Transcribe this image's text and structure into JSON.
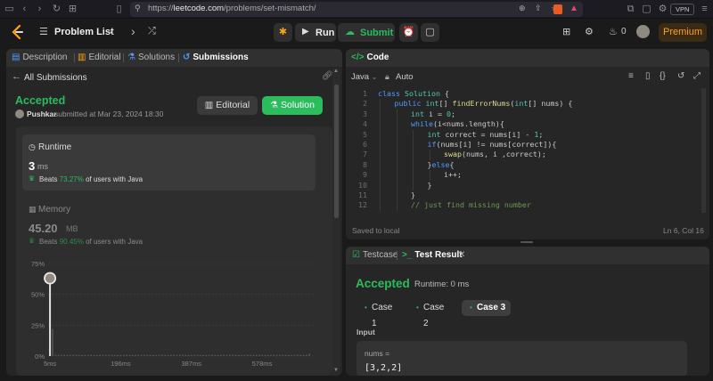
{
  "browser": {
    "url_prefix": "https://",
    "url_domain": "leetcode.com",
    "url_path": "/problems/set-mismatch/",
    "vpn_label": "VPN"
  },
  "topbar": {
    "problem_list_label": "Problem List",
    "run_label": "Run",
    "submit_label": "Submit",
    "streak_count": "0",
    "premium_label": "Premium"
  },
  "left_tabs": {
    "description": "Description",
    "editorial": "Editorial",
    "solutions": "Solutions",
    "submissions": "Submissions"
  },
  "submission": {
    "back_label": "All Submissions",
    "status": "Accepted",
    "user": "Pushkar",
    "submitted_text": "submitted at Mar 23, 2024 18:30",
    "editorial_button": "Editorial",
    "solution_button": "Solution",
    "runtime_title": "Runtime",
    "runtime_value": "3",
    "runtime_unit": "ms",
    "runtime_beats_prefix": "Beats",
    "runtime_beats_pct": "73.27%",
    "runtime_beats_suffix": "of users with Java",
    "memory_title": "Memory",
    "memory_value": "45.20",
    "memory_unit": "MB",
    "memory_beats_prefix": "Beats",
    "memory_beats_pct": "90.45%",
    "memory_beats_suffix": "of users with Java"
  },
  "chart_data": {
    "type": "bar",
    "y_ticks": [
      "75%",
      "50%",
      "25%",
      "0%"
    ],
    "y_tick_values": [
      75,
      50,
      25,
      0
    ],
    "x_ticks": [
      "5ms",
      "196ms",
      "387ms",
      "578ms"
    ],
    "x_tick_values": [
      5,
      196,
      387,
      578
    ],
    "ylim": [
      0,
      75
    ],
    "xlim": [
      0,
      720
    ],
    "highlight_x": 5,
    "highlight_y": 58,
    "values_x": [
      5,
      12,
      20,
      28,
      36,
      44,
      52,
      60,
      68,
      76,
      84,
      92,
      100,
      108,
      116,
      124,
      132,
      140,
      148,
      156,
      164,
      172,
      180,
      188,
      196,
      204,
      212,
      220,
      228,
      236,
      244,
      252,
      260,
      268,
      276,
      284,
      292,
      300,
      308,
      316,
      324,
      332,
      340,
      348,
      356,
      364,
      372,
      380,
      387,
      395,
      403,
      411,
      419,
      427,
      435,
      443,
      451,
      459,
      467,
      475,
      483,
      491,
      499,
      507,
      515,
      523,
      531,
      539,
      547,
      555,
      563,
      571,
      578,
      586,
      594,
      602,
      610,
      618,
      626,
      634,
      642,
      650,
      658,
      666,
      674,
      682,
      690,
      698,
      706
    ],
    "values_y": [
      58,
      22,
      1,
      1,
      1,
      1,
      1,
      1,
      1,
      1,
      1,
      1,
      1,
      1,
      1,
      1,
      1,
      1,
      1,
      1,
      1,
      1,
      1,
      1,
      1,
      1,
      1,
      1,
      1,
      1,
      1,
      1,
      1,
      1,
      1,
      1,
      1,
      1,
      1,
      1,
      1,
      1,
      1,
      1,
      1,
      1,
      1,
      1,
      1,
      1,
      1,
      1,
      1,
      1,
      1,
      1,
      1,
      1,
      1,
      1,
      1,
      1,
      1,
      1,
      1,
      1,
      1,
      1,
      1,
      1,
      1,
      1,
      1,
      1,
      1,
      1,
      1,
      1,
      1,
      1,
      1,
      1,
      1,
      1,
      1,
      1,
      1,
      1,
      2
    ]
  },
  "editor": {
    "tab_label": "Code",
    "language": "Java",
    "mode": "Auto",
    "status_left": "Saved to local",
    "status_right": "Ln 6, Col 16",
    "lines": [
      {
        "n": "1",
        "indent": 0,
        "parts": [
          [
            "kw",
            "class "
          ],
          [
            "ty",
            "Solution "
          ],
          [
            "pl",
            "{"
          ]
        ]
      },
      {
        "n": "2",
        "indent": 1,
        "parts": [
          [
            "kw",
            "public "
          ],
          [
            "ty",
            "int"
          ],
          [
            "pl",
            "[] "
          ],
          [
            "fn",
            "findErrorNums"
          ],
          [
            "pl",
            "("
          ],
          [
            "ty",
            "int"
          ],
          [
            "pl",
            "[] nums) {"
          ]
        ]
      },
      {
        "n": "3",
        "indent": 2,
        "parts": [
          [
            "ty",
            "int "
          ],
          [
            "pl",
            "i = "
          ],
          [
            "ty",
            "0"
          ],
          [
            "pl",
            ";"
          ]
        ]
      },
      {
        "n": "4",
        "indent": 2,
        "parts": [
          [
            "kw",
            "while"
          ],
          [
            "pl",
            "(i<nums.length){"
          ]
        ]
      },
      {
        "n": "5",
        "indent": 3,
        "parts": [
          [
            "ty",
            "int "
          ],
          [
            "pl",
            "correct = nums[i] - "
          ],
          [
            "ty",
            "1"
          ],
          [
            "pl",
            ";"
          ]
        ]
      },
      {
        "n": "6",
        "indent": 3,
        "parts": [
          [
            "kw",
            "if"
          ],
          [
            "pl",
            "(nums[i] != nums[correct]){"
          ]
        ]
      },
      {
        "n": "7",
        "indent": 4,
        "parts": [
          [
            "fn",
            "swap"
          ],
          [
            "pl",
            "(nums, i ,correct);"
          ]
        ]
      },
      {
        "n": "8",
        "indent": 3,
        "parts": [
          [
            "pl",
            "}"
          ],
          [
            "kw",
            "else"
          ],
          [
            "pl",
            "{"
          ]
        ]
      },
      {
        "n": "9",
        "indent": 4,
        "parts": [
          [
            "pl",
            "i++;"
          ]
        ]
      },
      {
        "n": "10",
        "indent": 3,
        "parts": [
          [
            "pl",
            "}"
          ]
        ]
      },
      {
        "n": "11",
        "indent": 2,
        "parts": [
          [
            "pl",
            "}"
          ]
        ]
      },
      {
        "n": "12",
        "indent": 2,
        "parts": [
          [
            "cm",
            "// just find missing number"
          ]
        ]
      }
    ]
  },
  "result": {
    "testcase_tab": "Testcase",
    "testresult_tab": "Test Result",
    "status": "Accepted",
    "runtime_text": "Runtime: 0 ms",
    "cases": [
      "Case 1",
      "Case 2",
      "Case 3"
    ],
    "active_case": 2,
    "input_label": "Input",
    "var_name": "nums =",
    "var_value": "[3,2,2]"
  },
  "colors": {
    "accent_green": "#2cbb5d",
    "premium_orange": "#ffa116",
    "panel_bg": "#262626"
  }
}
